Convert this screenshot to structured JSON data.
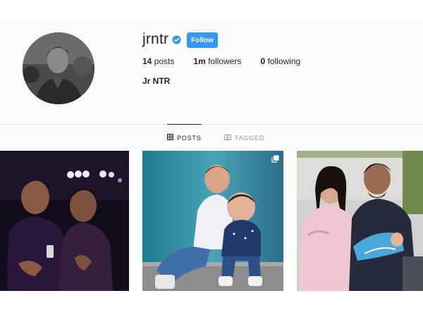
{
  "profile": {
    "username": "jrntr",
    "verified": true,
    "follow_label": "Follow",
    "full_name": "Jr NTR",
    "stats": [
      {
        "count": "14",
        "label": "posts"
      },
      {
        "count": "1m",
        "label": "followers"
      },
      {
        "count": "0",
        "label": "following"
      }
    ]
  },
  "tabs": [
    {
      "label": "POSTS",
      "icon": "grid-icon",
      "active": true
    },
    {
      "label": "TAGGED",
      "icon": "tag-person-icon",
      "active": false
    }
  ],
  "posts": [
    {
      "icon": "photo",
      "multi": false
    },
    {
      "icon": "photo",
      "multi": true
    },
    {
      "icon": "photo",
      "multi": false
    }
  ],
  "colors": {
    "accent": "#3897f0",
    "background": "#fafafa",
    "text": "#262626",
    "muted": "#999999"
  }
}
